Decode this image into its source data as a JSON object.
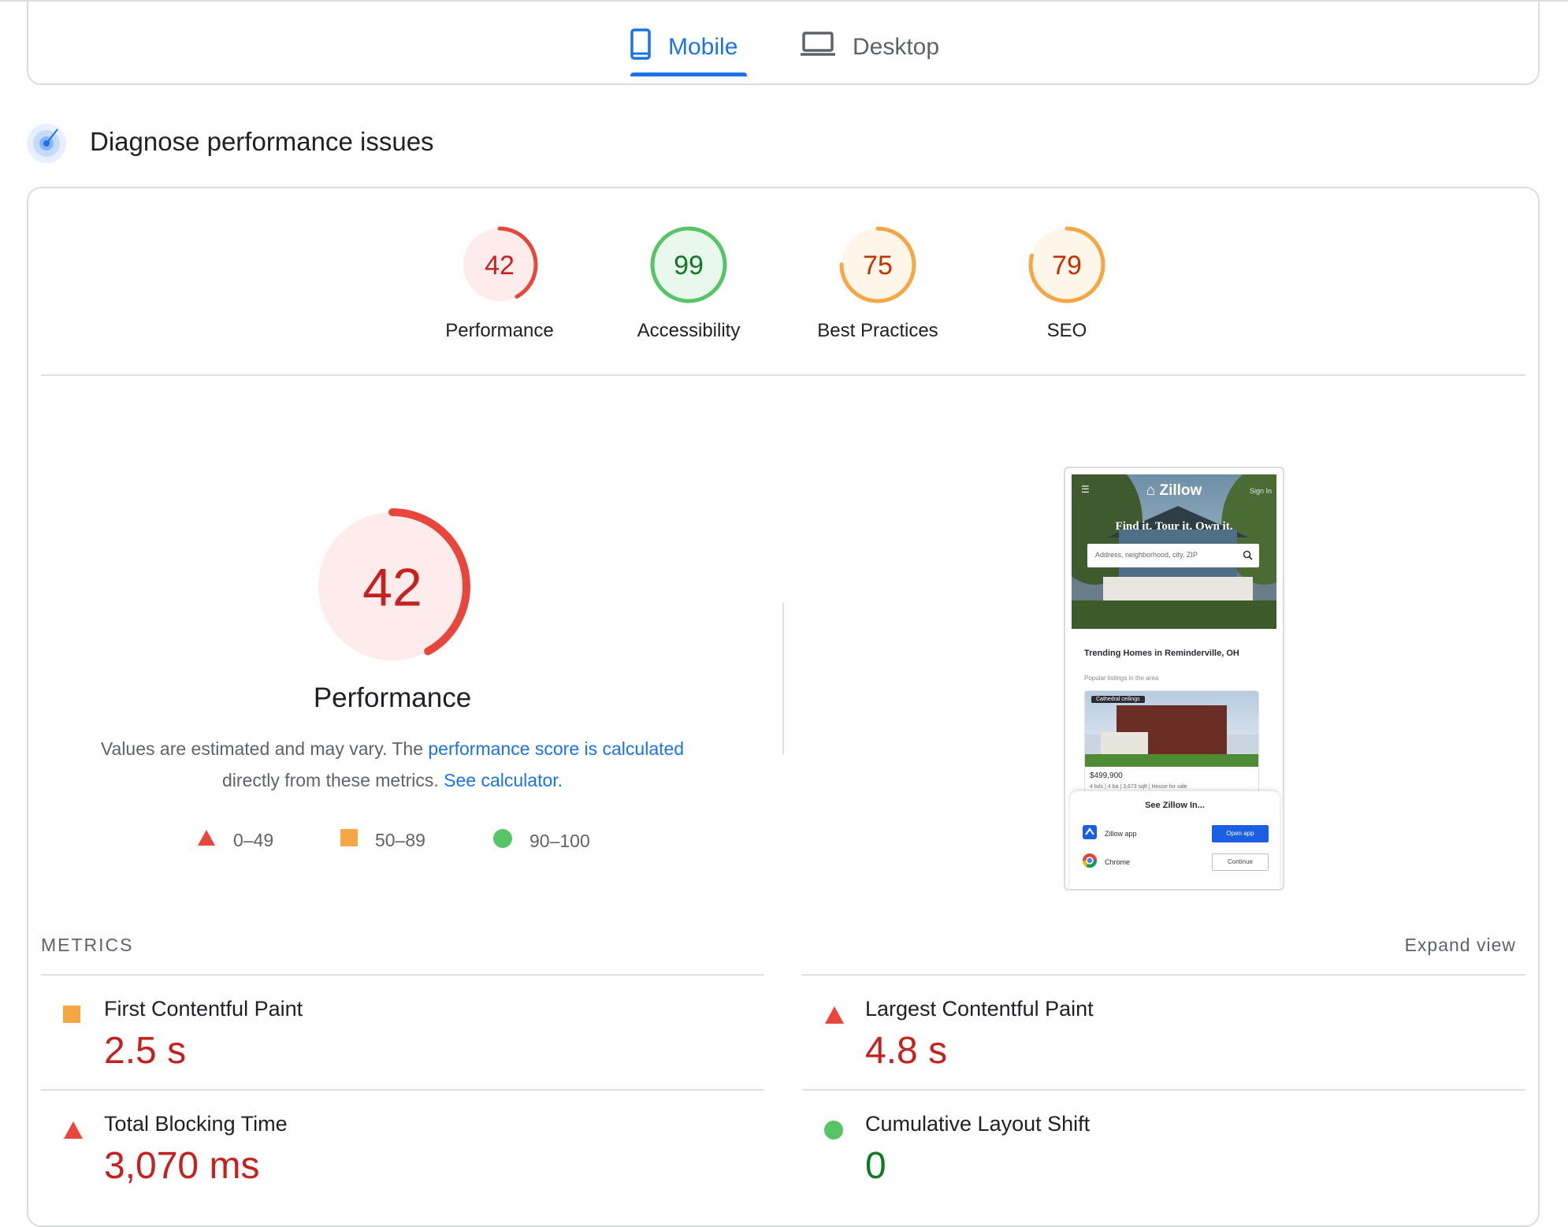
{
  "tabs": [
    {
      "label": "Mobile",
      "active": true,
      "icon": "smartphone-icon"
    },
    {
      "label": "Desktop",
      "active": false,
      "icon": "laptop-icon"
    }
  ],
  "section": {
    "title": "Diagnose performance issues",
    "icon": "radar-icon"
  },
  "scores": [
    {
      "label": "Performance",
      "value": "42",
      "score": 42,
      "status": "fail"
    },
    {
      "label": "Accessibility",
      "value": "99",
      "score": 99,
      "status": "pass"
    },
    {
      "label": "Best Practices",
      "value": "75",
      "score": 75,
      "status": "average"
    },
    {
      "label": "SEO",
      "value": "79",
      "score": 79,
      "status": "average"
    }
  ],
  "performance": {
    "score": "42",
    "score_num": 42,
    "title": "Performance",
    "desc_prefix": "Values are estimated and may vary. The ",
    "desc_link": "performance score is calculated",
    "desc_middle": " directly from these metrics. ",
    "desc_link2": "See calculator.",
    "legend": [
      {
        "range": "0–49",
        "shape": "triangle",
        "color": "#e8453c"
      },
      {
        "range": "50–89",
        "shape": "square",
        "color": "#f4a742"
      },
      {
        "range": "90–100",
        "shape": "circle",
        "color": "#57c465"
      }
    ]
  },
  "screenshot": {
    "logo": "Zillow",
    "sign_in": "Sign In",
    "tagline": "Find it. Tour it. Own it.",
    "search_placeholder": "Address, neighborhood, city, ZIP",
    "trending_title": "Trending Homes in Reminderville, OH",
    "trending_sub": "Popular listings in the area",
    "listing_tag": "Cathedral ceilings",
    "listing_price": "$499,900",
    "listing_meta": "4 bds  |  4 ba  |  3,673 sqft  |  House for sale",
    "sheet_title": "See Zillow In...",
    "apps": [
      {
        "name": "Zillow app",
        "action": "Open app"
      },
      {
        "name": "Chrome",
        "action": "Continue"
      }
    ]
  },
  "metrics": {
    "heading": "METRICS",
    "expand_label": "Expand view",
    "items": [
      {
        "label": "First Contentful Paint",
        "value": "2.5 s",
        "status": "average"
      },
      {
        "label": "Largest Contentful Paint",
        "value": "4.8 s",
        "status": "fail"
      },
      {
        "label": "Total Blocking Time",
        "value": "3,070 ms",
        "status": "fail"
      },
      {
        "label": "Cumulative Layout Shift",
        "value": "0",
        "status": "pass"
      }
    ]
  },
  "colors": {
    "accent": "#1a73e8",
    "fail": "#e8453c",
    "fail_text": "#c5221f",
    "fail_bg": "#fdeceb",
    "average": "#f4a742",
    "average_text": "#c33300",
    "average_bg": "#fff6ea",
    "pass": "#57c465",
    "pass_text": "#0d7a26",
    "pass_bg": "#e9f7ec"
  }
}
